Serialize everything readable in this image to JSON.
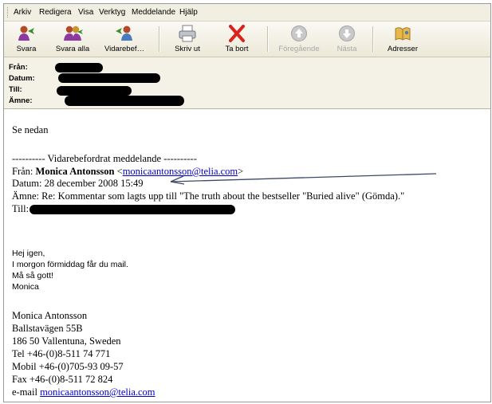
{
  "menu": [
    "Arkiv",
    "Redigera",
    "Visa",
    "Verktyg",
    "Meddelande",
    "Hjälp"
  ],
  "toolbar": {
    "reply": "Svara",
    "reply_all": "Svara alla",
    "forward": "Vidarebef…",
    "print": "Skriv ut",
    "delete": "Ta bort",
    "previous": "Föregående",
    "next": "Nästa",
    "addresses": "Adresser"
  },
  "header": {
    "from_label": "Från:",
    "date_label": "Datum:",
    "to_label": "Till:",
    "subject_label": "Ämne:"
  },
  "message": {
    "intro": "Se nedan",
    "forward_divider": "---------- Vidarebefordrat meddelande ----------",
    "from_prefix": "Från: ",
    "from_name": "Monica Antonsson",
    "from_lt": " <",
    "from_email": "monicaantonsson@telia.com",
    "from_gt": ">",
    "date_line": "Datum: 28 december 2008 15:49",
    "subject_line": "Ämne: Re: Kommentar som lagts upp till \"The truth about the bestseller \"Buried alive\" (Gömda).\"",
    "to_prefix": "Till:",
    "greeting": "Hej igen,",
    "line_tomorrow": "I morgon förmiddag får du mail.",
    "line_wish": "Må så gott!",
    "line_sign": "Monica",
    "sig_name": "Monica Antonsson",
    "sig_street": "Ballstavägen 55B",
    "sig_city": "186 50  Vallentuna, Sweden",
    "sig_tel": "Tel +46-(0)8-511 74 771",
    "sig_mobil": "Mobil +46-(0)705-93 09-57",
    "sig_fax": "Fax +46-(0)8-511 72 824",
    "sig_email_prefix": "e-mail ",
    "sig_email": "monicaantonsson@telia.com"
  }
}
